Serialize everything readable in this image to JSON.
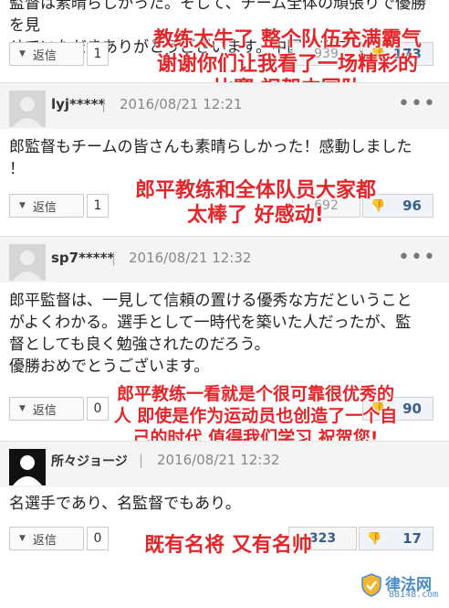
{
  "top_partial": {
    "body_text": "監督は素晴らしかった。そして、チーム全体の頑張りで優勝を見\nせていただきありがとうございます。中国おめでとう。",
    "reply_label": "返信",
    "reply_count": "1",
    "vote_down": "173",
    "vote_up": "939",
    "overlay": "教练太牛了 整个队伍充满霸气\n谢谢你们让我看了一场精彩的\n比赛 祝贺中国队"
  },
  "comments": [
    {
      "user": "lyj*****",
      "date": "2016/08/21 12:21",
      "body_text": "郎監督もチームの皆さんも素晴らしかった！感動しました\n！",
      "reply_label": "返信",
      "reply_count": "1",
      "vote_up": "692",
      "vote_down": "96",
      "overlay": "郎平教练和全体队员大家都\n太棒了 好感动!"
    },
    {
      "user": "sp7*****",
      "date": "2016/08/21 12:32",
      "body_text": "郎平監督は、一見して信頼の置ける優秀な方だということ\nがよくわかる。選手として一時代を築いた人だったが、監\n督としても良く勉強されたのだろう。\n優勝おめでとうございます。",
      "reply_label": "返信",
      "reply_count": "0",
      "vote_down": "90",
      "overlay": "郎平教练一看就是个很可靠很优秀的\n人 即使是作为运动员也创造了一个自\n己的时代 值得我们学习 祝贺您!"
    },
    {
      "user": "所々ジョージ",
      "date": "2016/08/21 12:32",
      "body_text": "名選手であり、名監督でもあり。",
      "reply_label": "返信",
      "reply_count": "0",
      "vote_up": "323",
      "vote_down": "17",
      "overlay": "既有名将 又有名帅"
    }
  ],
  "separator": "|",
  "more_glyph": "•••",
  "watermark": {
    "name": "律法网",
    "url": "88148.com"
  },
  "colors": {
    "overlay_red": "#e4262a",
    "vote_blue": "#3a5f8a",
    "watermark_blue": "#4a8dc9"
  }
}
